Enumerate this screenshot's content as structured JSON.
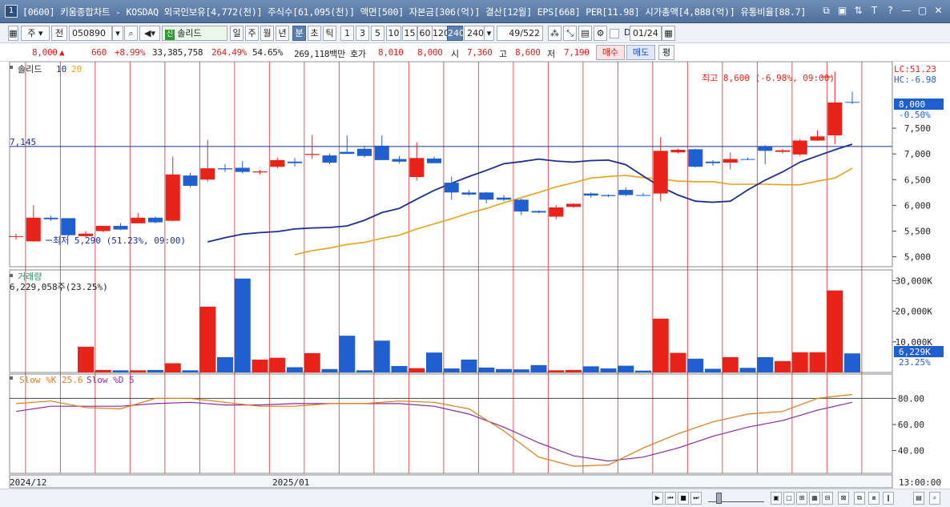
{
  "window": {
    "number": "1",
    "title": "[0600] 키움종합차트 - KOSDAQ 외국인보유[4,772(천)] 주식수[61,095(천)] 액면[500] 자본금[306(억)] 결산[12월] EPS[668] PER[11.98] 시가총액[4,888(억)] 유통비율[88.7]",
    "buttons": [
      "⧉",
      "▣",
      "⇅",
      "T",
      "?",
      "—",
      "▢",
      "✕"
    ]
  },
  "toolbar": {
    "market": "주",
    "prev_label": "전",
    "code": "050890",
    "badge": "신",
    "stock_name": "솔리드",
    "periods": [
      "일",
      "주",
      "월",
      "년",
      "분",
      "초",
      "틱"
    ],
    "active_period": "분",
    "minutes": [
      "1",
      "3",
      "5",
      "10",
      "15",
      "60",
      "120",
      "240"
    ],
    "active_minute": "240",
    "minute_value": "240",
    "count": "49",
    "total": "/522",
    "date": "01/24"
  },
  "quote": {
    "price": "8,000",
    "change_arrow": "▲",
    "change": "660",
    "change_pct": "+8.99%",
    "volume": "33,385,758",
    "volume_ratio": "264.49%",
    "turnover": "54.65%",
    "amount": "269,118백만",
    "hoga_label": "호가",
    "hoga_ask": "8,010",
    "hoga_bid": "8,000",
    "open_label": "시",
    "open": "7,360",
    "high_label": "고",
    "high": "8,600",
    "low_label": "저",
    "low": "7,190",
    "buy_button": "매수",
    "sell_button": "매도",
    "flat_button": "평"
  },
  "price_panel": {
    "legend_name": "솔리드",
    "ma_short": "10",
    "ma_long": "20",
    "high_annotation": "최고 8,600 (-6.98%, 09:00)",
    "low_annotation": "최저 5,290 (51.23%, 09:00)",
    "lc": "LC:51.23",
    "hc": "HC:-6.98",
    "hline_label": "7,145",
    "current_price": "8,000",
    "current_pct": "-0.50%",
    "yticks": [
      "7,500",
      "7,000",
      "6,500",
      "6,000",
      "5,500",
      "5,000"
    ]
  },
  "volume_panel": {
    "title": "거래량",
    "value_text": "6,229,058주(23.25%)",
    "yticks": [
      "30,000K",
      "20,000K",
      "10,000K"
    ],
    "current": "6,229K",
    "current_pct": "23.25%"
  },
  "stoch_panel": {
    "k_label": "Slow %K 25.6",
    "d_label": "Slow %D 5",
    "yticks": [
      "80.00",
      "60.00",
      "40.00"
    ]
  },
  "time_axis": {
    "left": "2024/12",
    "mid": "2025/01",
    "right": "13:00:00"
  },
  "colors": {
    "up": "#e8231a",
    "down": "#1f5fd0",
    "ma10": "#1a2f95",
    "ma20": "#e8a21a",
    "stoch_k": "#e07b1a",
    "stoch_d": "#8a2b9a",
    "vline": "#cc3333"
  },
  "chart_data": {
    "type": "candlestick",
    "x_range": "2024/12 – 2025/01",
    "y_range": [
      4900,
      8700
    ],
    "candles": [
      {
        "o": 5400,
        "h": 5450,
        "l": 5330,
        "c": 5400
      },
      {
        "o": 5300,
        "h": 6000,
        "l": 5290,
        "c": 5760
      },
      {
        "o": 5760,
        "h": 5800,
        "l": 5700,
        "c": 5730
      },
      {
        "o": 5750,
        "h": 5750,
        "l": 5400,
        "c": 5420
      },
      {
        "o": 5400,
        "h": 5500,
        "l": 5380,
        "c": 5450
      },
      {
        "o": 5500,
        "h": 5600,
        "l": 5480,
        "c": 5600
      },
      {
        "o": 5600,
        "h": 5650,
        "l": 5520,
        "c": 5530
      },
      {
        "o": 5650,
        "h": 5850,
        "l": 5650,
        "c": 5760
      },
      {
        "o": 5760,
        "h": 5780,
        "l": 5650,
        "c": 5670
      },
      {
        "o": 5700,
        "h": 6950,
        "l": 5690,
        "c": 6600
      },
      {
        "o": 6580,
        "h": 6630,
        "l": 6350,
        "c": 6380
      },
      {
        "o": 6500,
        "h": 7270,
        "l": 6460,
        "c": 6720
      },
      {
        "o": 6720,
        "h": 6800,
        "l": 6650,
        "c": 6700
      },
      {
        "o": 6730,
        "h": 6860,
        "l": 6620,
        "c": 6650
      },
      {
        "o": 6640,
        "h": 6690,
        "l": 6600,
        "c": 6660
      },
      {
        "o": 6750,
        "h": 6930,
        "l": 6720,
        "c": 6880
      },
      {
        "o": 6850,
        "h": 6920,
        "l": 6750,
        "c": 6820
      },
      {
        "o": 6980,
        "h": 7370,
        "l": 6900,
        "c": 7000
      },
      {
        "o": 6970,
        "h": 7010,
        "l": 6800,
        "c": 6830
      },
      {
        "o": 7040,
        "h": 7360,
        "l": 7000,
        "c": 7000
      },
      {
        "o": 7100,
        "h": 7160,
        "l": 6930,
        "c": 6960
      },
      {
        "o": 7160,
        "h": 7360,
        "l": 6890,
        "c": 6880
      },
      {
        "o": 6900,
        "h": 6960,
        "l": 6820,
        "c": 6850
      },
      {
        "o": 6550,
        "h": 7220,
        "l": 6480,
        "c": 6920
      },
      {
        "o": 6910,
        "h": 6950,
        "l": 6820,
        "c": 6820
      },
      {
        "o": 6440,
        "h": 6560,
        "l": 6110,
        "c": 6250
      },
      {
        "o": 6250,
        "h": 6300,
        "l": 6190,
        "c": 6210
      },
      {
        "o": 6250,
        "h": 6260,
        "l": 6040,
        "c": 6110
      },
      {
        "o": 6150,
        "h": 6200,
        "l": 6080,
        "c": 6110
      },
      {
        "o": 6110,
        "h": 6130,
        "l": 5810,
        "c": 5880
      },
      {
        "o": 5890,
        "h": 5900,
        "l": 5850,
        "c": 5860
      },
      {
        "o": 5780,
        "h": 6000,
        "l": 5730,
        "c": 5960
      },
      {
        "o": 5970,
        "h": 6040,
        "l": 5950,
        "c": 6030
      },
      {
        "o": 6230,
        "h": 6250,
        "l": 6150,
        "c": 6190
      },
      {
        "o": 6200,
        "h": 6210,
        "l": 6160,
        "c": 6180
      },
      {
        "o": 6300,
        "h": 6350,
        "l": 6180,
        "c": 6200
      },
      {
        "o": 6200,
        "h": 6240,
        "l": 6180,
        "c": 6190
      },
      {
        "o": 6230,
        "h": 7330,
        "l": 6080,
        "c": 7060
      },
      {
        "o": 7030,
        "h": 7100,
        "l": 7010,
        "c": 7080
      },
      {
        "o": 7090,
        "h": 7100,
        "l": 6740,
        "c": 6750
      },
      {
        "o": 6850,
        "h": 6880,
        "l": 6770,
        "c": 6820
      },
      {
        "o": 6830,
        "h": 7030,
        "l": 6700,
        "c": 6900
      },
      {
        "o": 6900,
        "h": 6930,
        "l": 6880,
        "c": 6890
      },
      {
        "o": 7140,
        "h": 7170,
        "l": 6800,
        "c": 7060
      },
      {
        "o": 7040,
        "h": 7100,
        "l": 7010,
        "c": 7070
      },
      {
        "o": 6990,
        "h": 7290,
        "l": 6960,
        "c": 7260
      },
      {
        "o": 7260,
        "h": 7460,
        "l": 7250,
        "c": 7340
      },
      {
        "o": 7360,
        "h": 8600,
        "l": 7190,
        "c": 8000
      },
      {
        "o": 8010,
        "h": 8210,
        "l": 7970,
        "c": 8000
      }
    ],
    "ma10": [
      5290,
      5370,
      5440,
      5470,
      5490,
      5540,
      5560,
      5570,
      5600,
      5710,
      5860,
      5940,
      6120,
      6290,
      6430,
      6560,
      6680,
      6810,
      6850,
      6900,
      6860,
      6840,
      6870,
      6880,
      6790,
      6570,
      6360,
      6200,
      6080,
      6060,
      6080,
      6300,
      6490,
      6650,
      6840,
      6960,
      7080,
      7190
    ],
    "ma20": [
      5040,
      5120,
      5170,
      5240,
      5280,
      5360,
      5420,
      5540,
      5640,
      5740,
      5850,
      5940,
      6050,
      6150,
      6250,
      6360,
      6440,
      6530,
      6560,
      6580,
      6540,
      6510,
      6470,
      6460,
      6460,
      6410,
      6410,
      6410,
      6400,
      6400,
      6470,
      6530,
      6720
    ],
    "volume_k": [
      8400,
      800,
      700,
      700,
      800,
      3000,
      700,
      21500,
      5000,
      30700,
      4200,
      4800,
      1700,
      6300,
      1100,
      12000,
      700,
      10400,
      2100,
      1400,
      6500,
      1300,
      4200,
      1600,
      1100,
      1000,
      2400,
      700,
      800,
      2000,
      1300,
      2200,
      600,
      17600,
      6400,
      4500,
      1200,
      5000,
      1500,
      5000,
      3700,
      6600,
      6600,
      26800,
      6229
    ],
    "stoch_k": [
      76,
      78,
      73,
      72,
      80,
      80,
      77,
      74,
      74,
      76,
      76,
      78,
      77,
      72,
      55,
      35,
      28,
      29,
      42,
      53,
      62,
      68,
      70,
      80,
      83
    ],
    "stoch_d": [
      70,
      74,
      74,
      74,
      76,
      77,
      75,
      75,
      76,
      76,
      76,
      76,
      74,
      68,
      58,
      46,
      36,
      32,
      35,
      42,
      51,
      58,
      63,
      71,
      77
    ]
  }
}
